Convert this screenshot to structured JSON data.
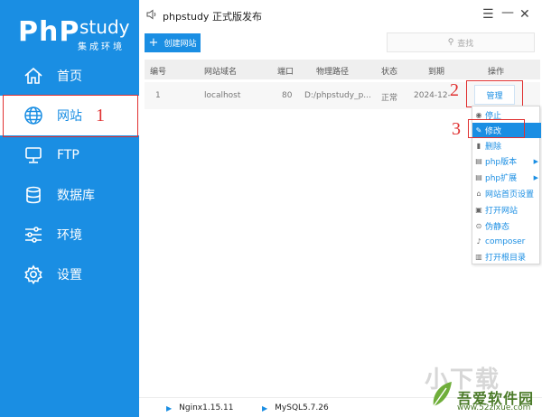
{
  "app": {
    "logo_main": "PhP",
    "logo_study": "study",
    "logo_sub": "集成环境",
    "window_title": "phpstudy 正式版发布"
  },
  "sidebar": {
    "items": [
      {
        "label": "首页",
        "icon": "home-icon"
      },
      {
        "label": "网站",
        "icon": "globe-icon",
        "active": true
      },
      {
        "label": "FTP",
        "icon": "monitor-icon"
      },
      {
        "label": "数据库",
        "icon": "database-icon"
      },
      {
        "label": "环境",
        "icon": "sliders-icon"
      },
      {
        "label": "设置",
        "icon": "gear-icon"
      }
    ]
  },
  "toolbar": {
    "create_label": "创建网站",
    "search_placeholder": "查找"
  },
  "table": {
    "headers": [
      "编号",
      "网站域名",
      "端口",
      "物理路径",
      "状态",
      "到期",
      "操作"
    ],
    "rows": [
      {
        "id": "1",
        "domain": "localhost",
        "port": "80",
        "path": "D:/phpstudy_p...",
        "status": "正常",
        "expire": "2024-12-",
        "action": "管理"
      }
    ]
  },
  "menu": {
    "items": [
      {
        "label": "停止",
        "icon": "stop-icon"
      },
      {
        "label": "修改",
        "icon": "edit-icon",
        "highlight": true
      },
      {
        "label": "删除",
        "icon": "trash-icon"
      },
      {
        "label": "php版本",
        "icon": "php-icon",
        "submenu": true
      },
      {
        "label": "php扩展",
        "icon": "php-ext-icon",
        "submenu": true
      },
      {
        "label": "网站首页设置",
        "icon": "home-small-icon"
      },
      {
        "label": "打开网站",
        "icon": "open-site-icon"
      },
      {
        "label": "伪静态",
        "icon": "rewrite-icon"
      },
      {
        "label": "composer",
        "icon": "composer-icon"
      },
      {
        "label": "打开根目录",
        "icon": "folder-icon"
      }
    ]
  },
  "annotations": [
    "1",
    "2",
    "3"
  ],
  "status": {
    "nginx": "Nginx1.15.11",
    "mysql": "MySQL5.7.26"
  },
  "watermark": {
    "title": "吾爱软件园",
    "url": "www.52zixue.com",
    "faded": "小下载"
  },
  "colors": {
    "accent": "#1a8ee3",
    "annotation": "#e03030"
  }
}
